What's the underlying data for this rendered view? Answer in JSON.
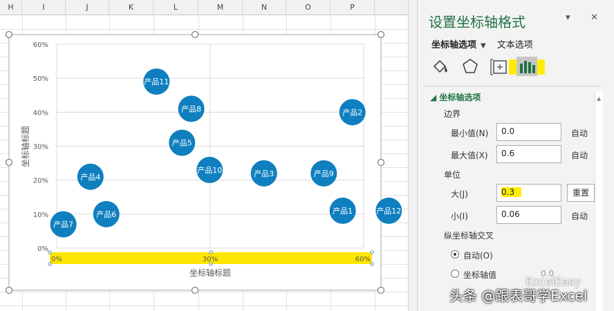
{
  "sheet": {
    "columns": [
      "H",
      "I",
      "J",
      "K",
      "L",
      "M",
      "N",
      "O",
      "P"
    ]
  },
  "chart_data": {
    "type": "scatter",
    "xlabel": "坐标轴标题",
    "ylabel": "坐标轴标题",
    "xlim": [
      0,
      0.6
    ],
    "ylim": [
      0,
      0.6
    ],
    "x_ticks": [
      "0%",
      "30%",
      "60%"
    ],
    "y_ticks": [
      "0%",
      "10%",
      "20%",
      "30%",
      "40%",
      "50%",
      "60%"
    ],
    "x_axis_selected": true,
    "grid": true,
    "bubble_color": "#0f7fbf",
    "points": [
      {
        "label": "产品11",
        "x": 0.195,
        "y": 0.49
      },
      {
        "label": "产品8",
        "x": 0.263,
        "y": 0.41
      },
      {
        "label": "产品2",
        "x": 0.578,
        "y": 0.4
      },
      {
        "label": "产品5",
        "x": 0.245,
        "y": 0.31
      },
      {
        "label": "产品10",
        "x": 0.299,
        "y": 0.23
      },
      {
        "label": "产品3",
        "x": 0.405,
        "y": 0.22
      },
      {
        "label": "产品9",
        "x": 0.522,
        "y": 0.22
      },
      {
        "label": "产品4",
        "x": 0.066,
        "y": 0.21
      },
      {
        "label": "产品1",
        "x": 0.559,
        "y": 0.11
      },
      {
        "label": "产品12",
        "x": 0.649,
        "y": 0.11
      },
      {
        "label": "产品6",
        "x": 0.097,
        "y": 0.1
      },
      {
        "label": "产品7",
        "x": 0.013,
        "y": 0.07
      }
    ]
  },
  "pane": {
    "title": "设置坐标轴格式",
    "dropdown_icon": "caret-down",
    "close_icon": "close",
    "tab_axis": "坐标轴选项",
    "tab_text": "文本选项",
    "section": "坐标轴选项",
    "bounds_label": "边界",
    "min_label": "最小值(N)",
    "min_value": "0.0",
    "max_label": "最大值(X)",
    "max_value": "0.6",
    "auto_label": "自动",
    "units_label": "单位",
    "major_label": "大(J)",
    "major_value": "0.3",
    "reset_label": "重置",
    "minor_label": "小(I)",
    "minor_value": "0.06",
    "cross_label": "纵坐标轴交叉",
    "cross_auto": "自动(O)",
    "cross_value_label": "坐标轴值",
    "cross_value": "0.0",
    "accent_color": "#217346",
    "highlight_color": "#ffee00"
  },
  "watermark": {
    "line1": "ExcelEasy",
    "line2": "头条 @跟表哥学Excel"
  }
}
